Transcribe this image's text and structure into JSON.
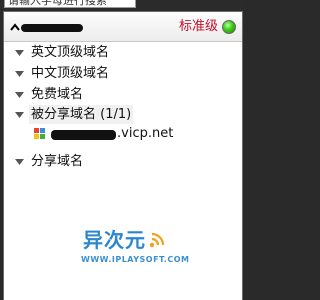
{
  "search": {
    "placeholder": "请输入字母进行搜索"
  },
  "header": {
    "collapse_icon": "caret-up-icon",
    "level_label": "标准级",
    "status_color": "#39c916"
  },
  "tree": {
    "groups": [
      {
        "label": "英文顶级域名",
        "expanded": true
      },
      {
        "label": "中文顶级域名",
        "expanded": true
      },
      {
        "label": "免费域名",
        "expanded": true
      },
      {
        "label": "被分享域名 (1/1)",
        "expanded": true,
        "selected": true,
        "items": [
          {
            "domain_suffix": ".vicp.net",
            "icon": "site-icon"
          }
        ]
      },
      {
        "label": "分享域名",
        "expanded": true
      }
    ]
  },
  "watermark": {
    "title": "异次元",
    "url": "WWW.IPLAYSOFT.COM"
  },
  "colors": {
    "accent_red": "#c0102a",
    "watermark_blue": "#2a86cf"
  }
}
